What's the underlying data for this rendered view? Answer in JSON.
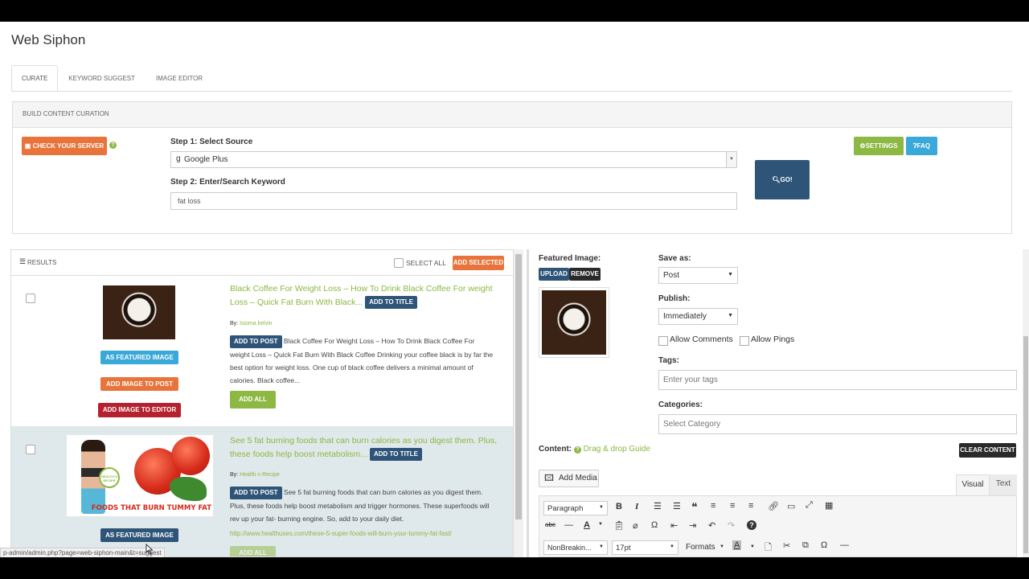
{
  "app": {
    "title": "Web Siphon"
  },
  "tabs": [
    {
      "label": "CURATE",
      "active": true
    },
    {
      "label": "KEYWORD SUGGEST",
      "active": false
    },
    {
      "label": "IMAGE EDITOR",
      "active": false
    }
  ],
  "curation": {
    "header": "BUILD CONTENT CURATION",
    "check_server_label": "CHECK YOUR SERVER",
    "step1_label": "Step 1: Select Source",
    "source_value": "Google Plus",
    "step2_label": "Step 2: Enter/Search Keyword",
    "keyword_value": "fat loss",
    "go_label": "GO!",
    "settings_label": "SETTINGS",
    "faq_label": "FAQ"
  },
  "results": {
    "header": "RESULTS",
    "select_all_label": "SELECT ALL",
    "add_selected_label": "ADD SELECTED",
    "items": [
      {
        "title": "Black Coffee For Weight Loss – How To Drink Black Coffee For weight Loss – Quick Fat Burn With Black...",
        "add_title_label": "ADD TO TITLE",
        "by_prefix": "By:",
        "author": "Isioma kelvin",
        "add_post_label": "ADD TO POST",
        "description": "Black Coffee For Weight Loss – How To Drink Black Coffee For weight Loss – Quick Fat Burn With Black Coffee Drinking your coffee black is by far the best option for weight loss. One cup of black coffee delivers a minimal amount of calories. Black coffee...",
        "add_all_label": "ADD ALL",
        "featured_label": "AS FEATURED IMAGE",
        "image_post_label": "ADD IMAGE TO POST",
        "image_editor_label": "ADD IMAGE TO EDITOR"
      },
      {
        "title": "See 5 fat burning foods that can burn calories as you digest them. Plus, these foods help boost metabolism...",
        "add_title_label": "ADD TO TITLE",
        "by_prefix": "By:",
        "author": "Health n Recipe",
        "add_post_label": "ADD TO POST",
        "description": "See 5 fat burning foods that can burn calories as you digest them. Plus, these foods help boost metabolism and trigger hormones. These superfoods will rev up your fat- burning engine. So, add to your daily diet.",
        "link": "http://www.healthuses.com/these-5-super-foods-will-burn-your-tummy-fat-fast/",
        "add_all_label": "ADD ALL",
        "featured_label": "AS FEATURED IMAGE",
        "image_caption": "FOODS THAT BURN TUMMY FAT",
        "image_badge": "HEALTH N RECIPE"
      }
    ]
  },
  "editor": {
    "featured_label": "Featured Image:",
    "upload_label": "UPLOAD",
    "remove_label": "REMOVE",
    "save_as_label": "Save as:",
    "save_as_value": "Post",
    "publish_label": "Publish:",
    "publish_value": "Immediately",
    "allow_comments": "Allow Comments",
    "allow_pings": "Allow Pings",
    "tags_label": "Tags:",
    "tags_placeholder": "Enter your tags",
    "categories_label": "Categories:",
    "categories_placeholder": "Select Category",
    "content_label": "Content:",
    "drag_guide": "Drag & drop Guide",
    "clear_label": "CLEAR CONTENT",
    "add_media_label": "Add Media",
    "visual_tab": "Visual",
    "text_tab": "Text",
    "format_value": "Paragraph",
    "font_value": "NonBreakin...",
    "size_value": "17pt",
    "formats_label": "Formats"
  },
  "status_bar": {
    "url": "p-admin/admin.php?page=web-siphon-main&t=suggest"
  }
}
